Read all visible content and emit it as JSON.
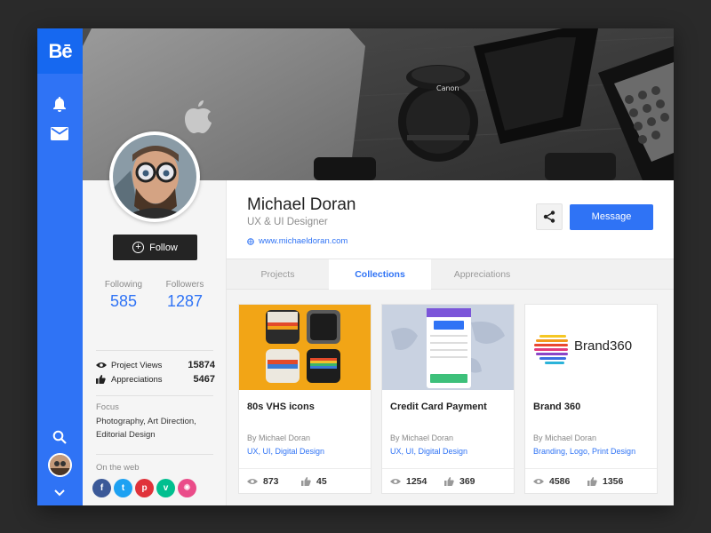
{
  "brand": {
    "logo_text": "Bē",
    "accent": "#2f73f5"
  },
  "rail": {
    "icons": [
      "bell-icon",
      "mail-icon",
      "search-icon",
      "chevron-down-icon"
    ]
  },
  "profile": {
    "name": "Michael Doran",
    "role": "UX & UI Designer",
    "website": "www.michaeldoran.com",
    "follow_label": "Follow",
    "message_label": "Message",
    "following_label": "Following",
    "following_value": "585",
    "followers_label": "Followers",
    "followers_value": "1287",
    "project_views_label": "Project Views",
    "project_views_value": "15874",
    "appreciations_label": "Appreciations",
    "appreciations_value": "5467",
    "focus_label": "Focus",
    "focus_text": "Photography, Art Direction, Editorial Design",
    "web_label": "On the web",
    "socials": [
      {
        "letter": "f",
        "color": "#3b5998"
      },
      {
        "letter": "t",
        "color": "#1da1f2"
      },
      {
        "letter": "p",
        "color": "#e0323a"
      },
      {
        "letter": "v",
        "color": "#00bf8f"
      },
      {
        "letter": "✺",
        "color": "#ea4c89"
      }
    ]
  },
  "tabs": [
    "Projects",
    "Collections",
    "Appreciations"
  ],
  "active_tab": "Collections",
  "cards": [
    {
      "title": "80s VHS icons",
      "by": "By Michael Doran",
      "tags": "UX, UI, Digital Design",
      "views": "873",
      "likes": "45"
    },
    {
      "title": "Credit Card Payment",
      "by": "By Michael Doran",
      "tags": "UX, UI, Digital Design",
      "views": "1254",
      "likes": "369"
    },
    {
      "title": "Brand 360",
      "by": "By Michael Doran",
      "tags": "Branding, Logo, Print Design",
      "views": "4586",
      "likes": "1356"
    }
  ],
  "brand360_logo_text": "Brand360"
}
